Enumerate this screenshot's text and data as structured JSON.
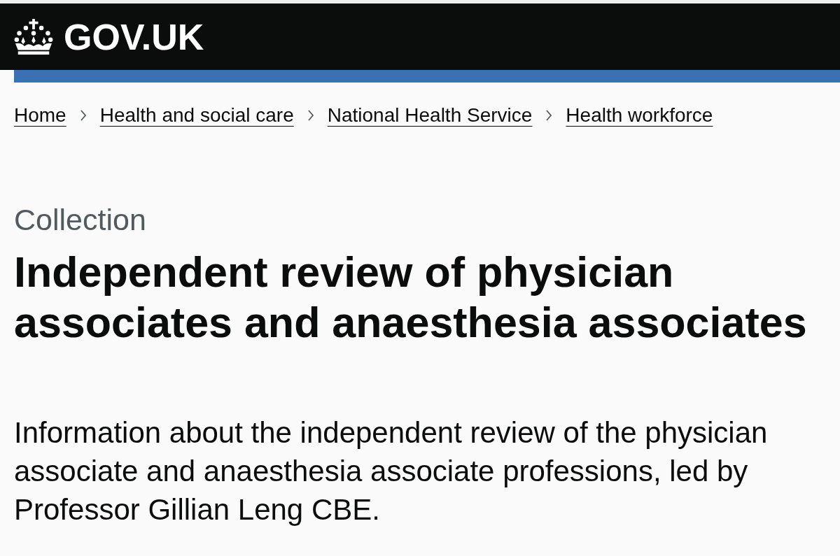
{
  "header": {
    "logo_text": "GOV.UK"
  },
  "breadcrumbs": [
    "Home",
    "Health and social care",
    "National Health Service",
    "Health workforce"
  ],
  "caption": "Collection",
  "title": "Independent review of physician associates and anaesthesia associates",
  "description": "Information about the independent review of the physician associate and anaesthesia associate professions, led by Professor Gillian Leng CBE."
}
